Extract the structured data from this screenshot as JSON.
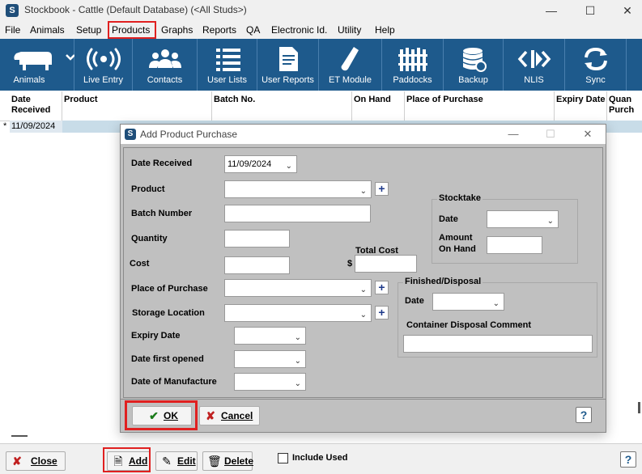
{
  "window": {
    "title": "Stockbook - Cattle (Default Database) (<All Studs>)",
    "minimize": "—",
    "maximize": "☐",
    "close": "✕"
  },
  "menu": [
    "File",
    "Animals",
    "Setup",
    "Products",
    "Graphs",
    "Reports",
    "QA",
    "Electronic Id.",
    "Utility",
    "Help"
  ],
  "toolbar": [
    {
      "label": "Animals",
      "icon": "cow-icon"
    },
    {
      "label": "Live Entry",
      "icon": "radio-waves-icon"
    },
    {
      "label": "Contacts",
      "icon": "people-icon"
    },
    {
      "label": "User Lists",
      "icon": "list-icon"
    },
    {
      "label": "User Reports",
      "icon": "report-icon"
    },
    {
      "label": "ET Module",
      "icon": "test-tube-icon"
    },
    {
      "label": "Paddocks",
      "icon": "fence-icon"
    },
    {
      "label": "Backup",
      "icon": "database-icon"
    },
    {
      "label": "NLIS",
      "icon": "nlis-icon"
    },
    {
      "label": "Sync",
      "icon": "sync-icon"
    }
  ],
  "grid": {
    "headers": {
      "date_received": "Date Received",
      "product": "Product",
      "batch_no": "Batch No.",
      "on_hand": "On Hand",
      "place_of_purchase": "Place of Purchase",
      "expiry_date": "Expiry Date",
      "quantity_purchased": "Quan Purch"
    },
    "new_row_marker": "*",
    "row_date": "11/09/2024"
  },
  "dialog": {
    "title": "Add Product Purchase",
    "labels": {
      "date_received": "Date Received",
      "product": "Product",
      "batch_number": "Batch Number",
      "quantity": "Quantity",
      "cost": "Cost",
      "total_cost": "Total Cost",
      "currency": "$",
      "place_of_purchase": "Place of Purchase",
      "storage_location": "Storage Location",
      "expiry_date": "Expiry Date",
      "date_first_opened": "Date first opened",
      "date_of_manufacture": "Date of Manufacture",
      "stocktake": "Stocktake",
      "stocktake_date": "Date",
      "amount_on_hand_1": "Amount",
      "amount_on_hand_2": "On Hand",
      "finished_disposal": "Finished/Disposal",
      "disposal_date": "Date",
      "container_disposal_comment": "Container Disposal Comment"
    },
    "values": {
      "date_received": "11/09/2024",
      "product": "",
      "batch_number": "",
      "quantity": "",
      "cost": "",
      "total_cost": "",
      "place_of_purchase": "",
      "storage_location": "",
      "expiry_date": "",
      "date_first_opened": "",
      "date_of_manufacture": "",
      "stocktake_date": "",
      "amount_on_hand": "",
      "disposal_date": "",
      "container_disposal_comment": ""
    },
    "buttons": {
      "ok": "OK",
      "cancel": "Cancel",
      "help": "?",
      "add": "+"
    }
  },
  "bottom": {
    "close": "Close",
    "add": "Add",
    "edit": "Edit",
    "delete": "Delete",
    "include_used": "Include  Used",
    "help": "?"
  },
  "colors": {
    "toolbar": "#1e5a8c",
    "highlight": "#e02020",
    "dialog_bg": "#c0c0c0"
  }
}
